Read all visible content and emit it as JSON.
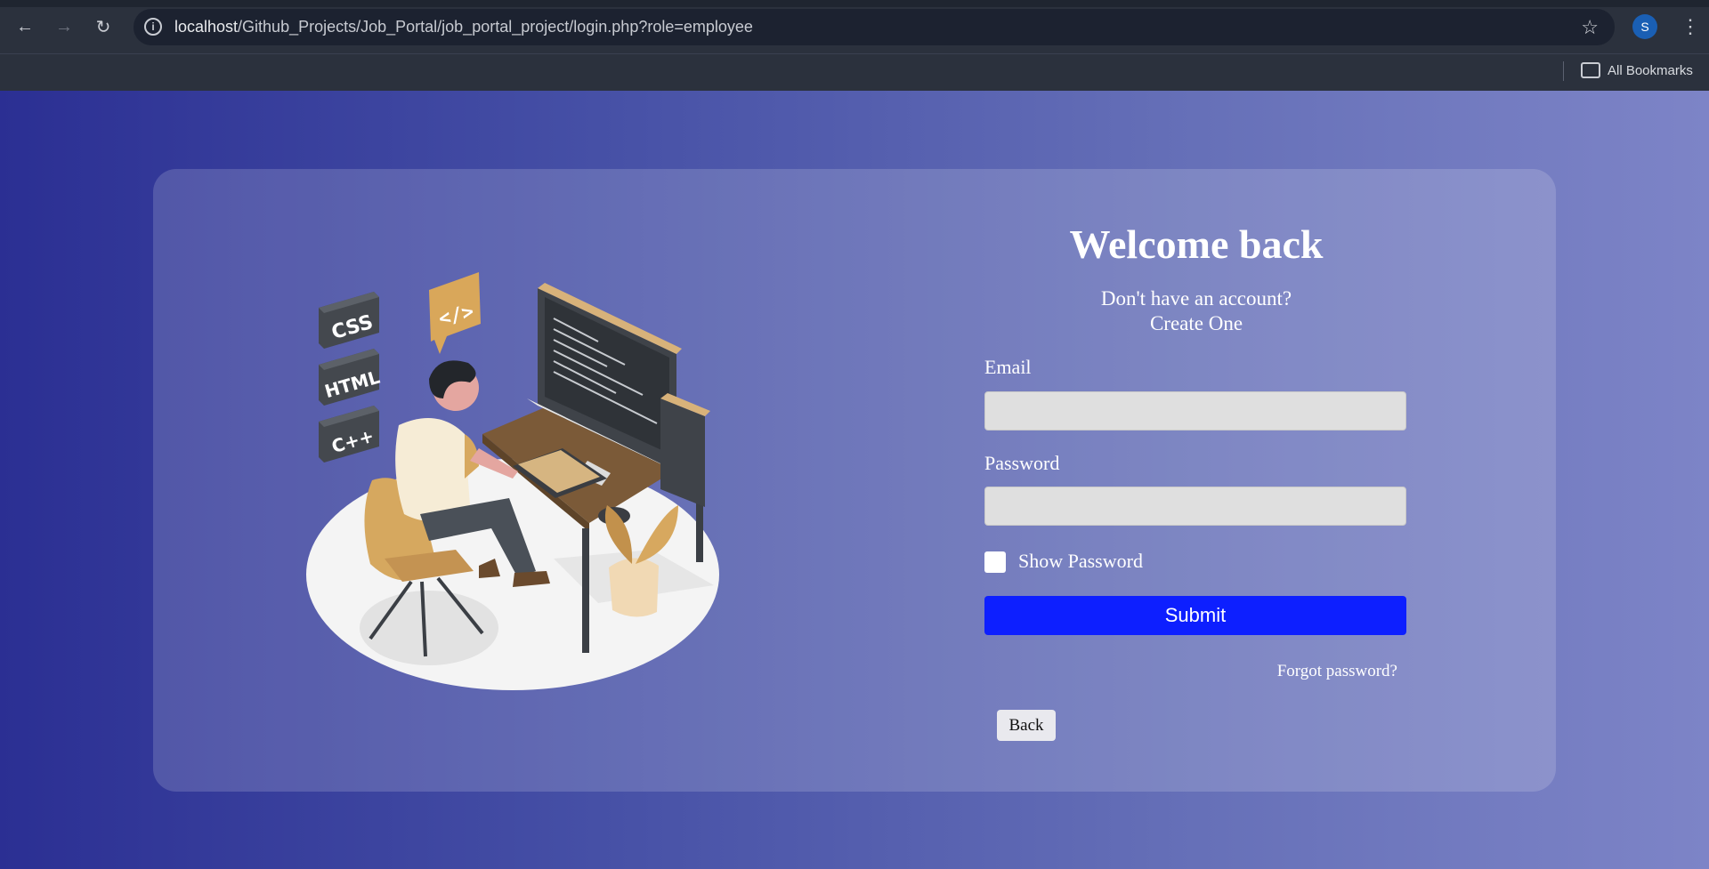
{
  "browser": {
    "url_host": "localhost",
    "url_path": "/Github_Projects/Job_Portal/job_portal_project/login.php?role=employee",
    "profile_initial": "S",
    "bookmarks_label": "All Bookmarks"
  },
  "login": {
    "title": "Welcome back",
    "no_account_text": "Don't have an account?",
    "create_link": "Create One",
    "email_label": "Email",
    "email_value": "",
    "password_label": "Password",
    "password_value": "",
    "show_password_label": "Show Password",
    "show_password_checked": false,
    "submit_label": "Submit",
    "forgot_label": "Forgot password?",
    "back_label": "Back"
  },
  "illustration": {
    "tags": [
      "CSS",
      "HTML",
      "C++"
    ],
    "code_bubble": "</>"
  },
  "colors": {
    "submit": "#0d1fff",
    "gradient_start": "#2b2f93",
    "gradient_end": "#7d84c7"
  }
}
